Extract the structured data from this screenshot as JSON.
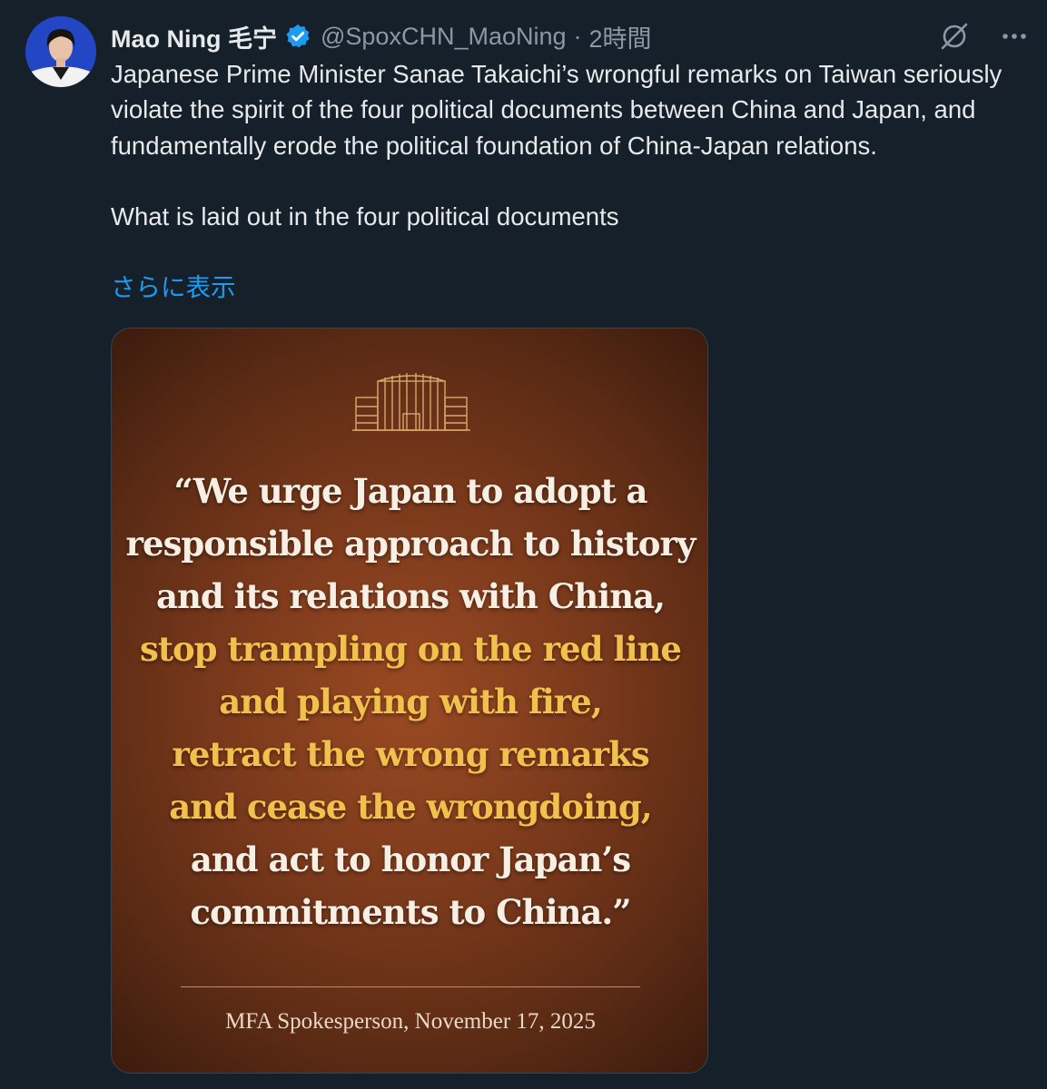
{
  "tweet": {
    "author": {
      "display_name": "Mao Ning 毛宁",
      "handle": "@SpoxCHN_MaoNing",
      "verified": true,
      "avatar": "avatar"
    },
    "separator": "·",
    "timestamp": "2時間",
    "text": "Japanese Prime Minister Sanae Takaichi’s wrongful remarks on Taiwan seriously violate the spirit of the four political documents between China and Japan, and fundamentally erode the political foundation of China-Japan relations.\n\nWhat is laid out in the four political documents",
    "show_more_label": "さらに表示",
    "icons": {
      "grok": "grok-icon",
      "more": "more-icon",
      "verified": "verified-badge-icon"
    }
  },
  "media": {
    "emblem": "building-icon",
    "quote_lines": [
      {
        "text": "“We urge Japan to adopt a",
        "color": "white"
      },
      {
        "text": "responsible approach to history",
        "color": "white"
      },
      {
        "text": "and its relations with China,",
        "color": "white"
      },
      {
        "text": "stop trampling on the red line",
        "color": "gold"
      },
      {
        "text": "and playing with fire,",
        "color": "gold"
      },
      {
        "text": "retract the wrong remarks",
        "color": "gold"
      },
      {
        "text": "and cease the wrongdoing,",
        "color": "gold"
      },
      {
        "text": "and act to honor Japan’s",
        "color": "white"
      },
      {
        "text": "commitments to China.”",
        "color": "white"
      }
    ],
    "attribution": "MFA Spokesperson, November 17, 2025",
    "colors": {
      "white_text": "#f7efe4",
      "gold_text": "#f2c04d",
      "background": "#7c3a1c"
    }
  },
  "colors": {
    "page_background": "#15202b",
    "link": "#1d9bf0",
    "secondary_text": "#8b98a5",
    "verified": "#1d9bf0"
  }
}
